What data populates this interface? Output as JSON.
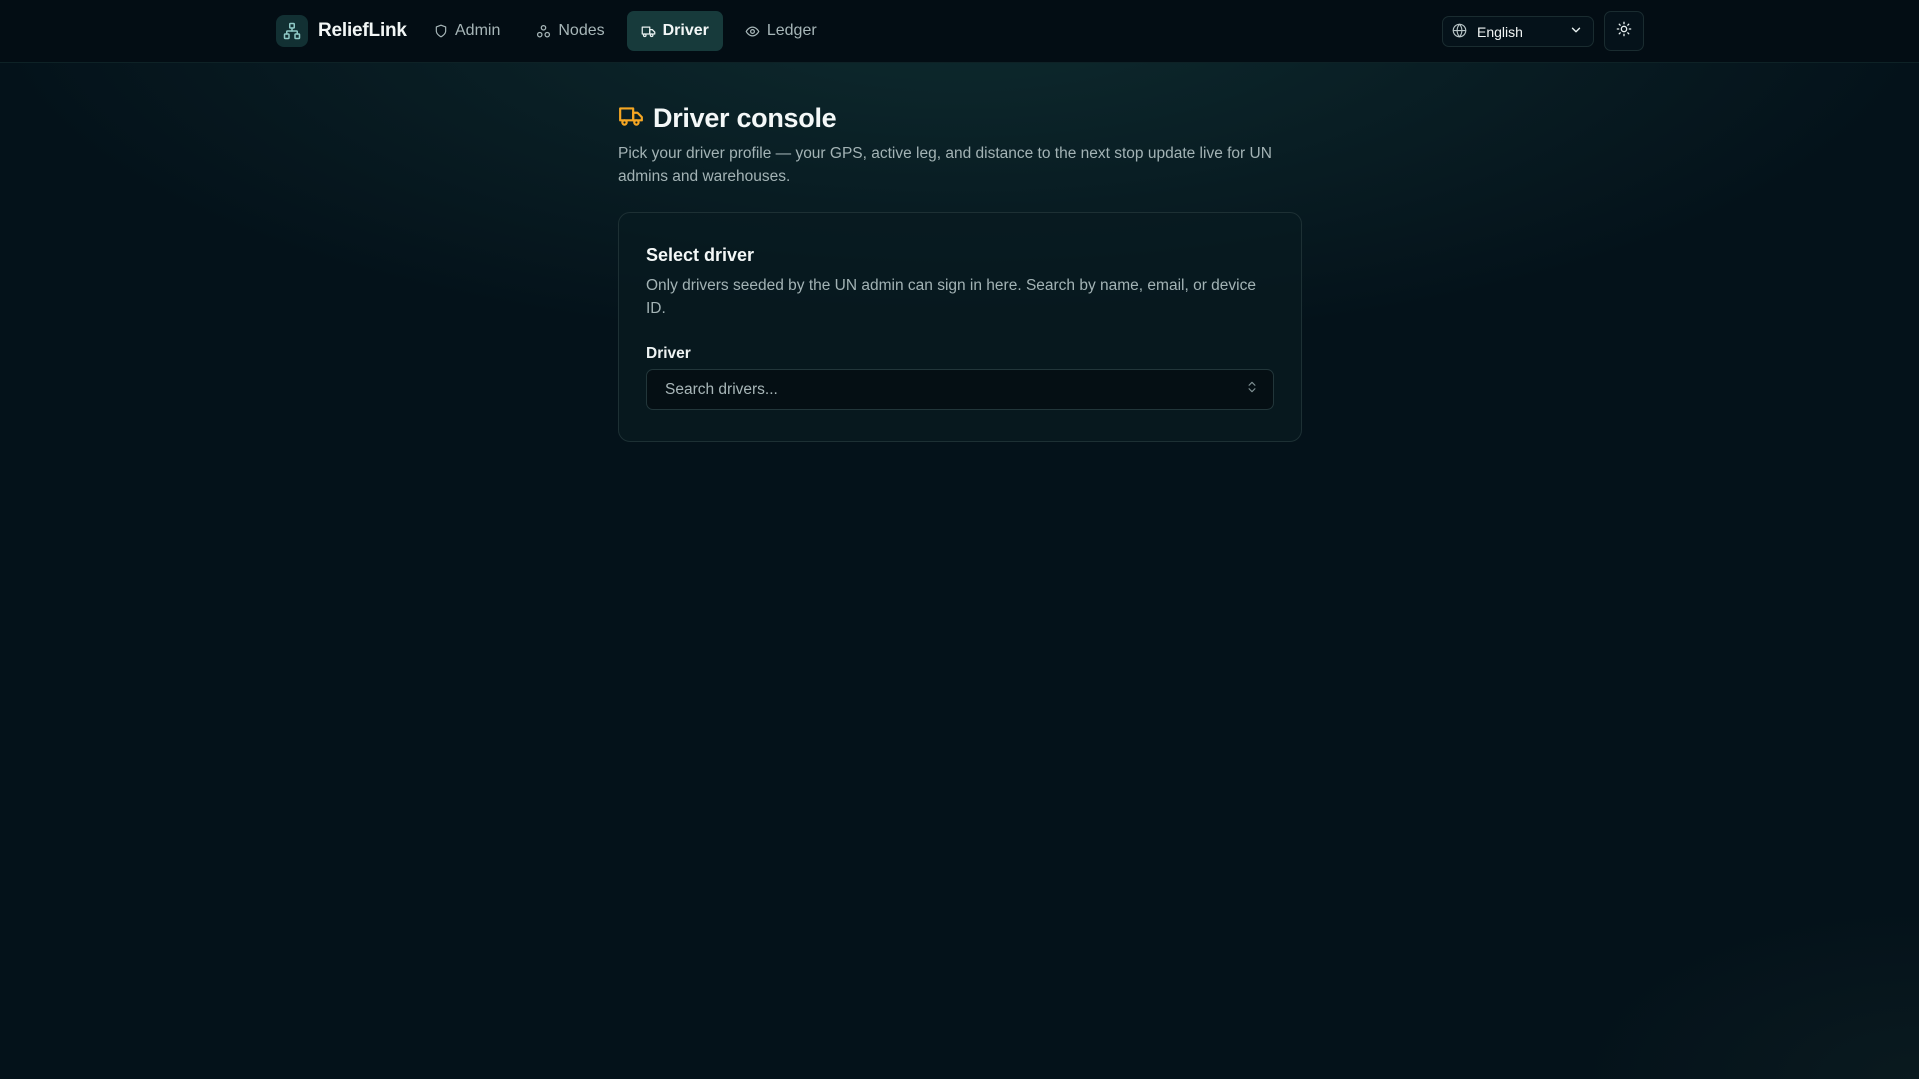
{
  "header": {
    "brand": "ReliefLink",
    "brand_icon": "network-icon",
    "nav": [
      {
        "label": "Admin",
        "icon": "shield-icon",
        "active": false
      },
      {
        "label": "Nodes",
        "icon": "nodes-icon",
        "active": false
      },
      {
        "label": "Driver",
        "icon": "truck-icon",
        "active": true
      },
      {
        "label": "Ledger",
        "icon": "eye-icon",
        "active": false
      }
    ],
    "language": {
      "selected": "English",
      "icon": "globe-icon"
    },
    "theme_toggle_icon": "sun-icon"
  },
  "page": {
    "title": "Driver console",
    "title_icon": "truck-icon",
    "subtitle": "Pick your driver profile — your GPS, active leg, and distance to the next stop update live for UN admins and warehouses."
  },
  "card": {
    "title": "Select driver",
    "description": "Only drivers seeded by the UN admin can sign in here. Search by name, email, or device ID.",
    "field_label": "Driver",
    "search_placeholder": "Search drivers..."
  },
  "colors": {
    "accent": "#f5a623",
    "active_nav_bg": "#173a3b",
    "background": "#04121a"
  }
}
